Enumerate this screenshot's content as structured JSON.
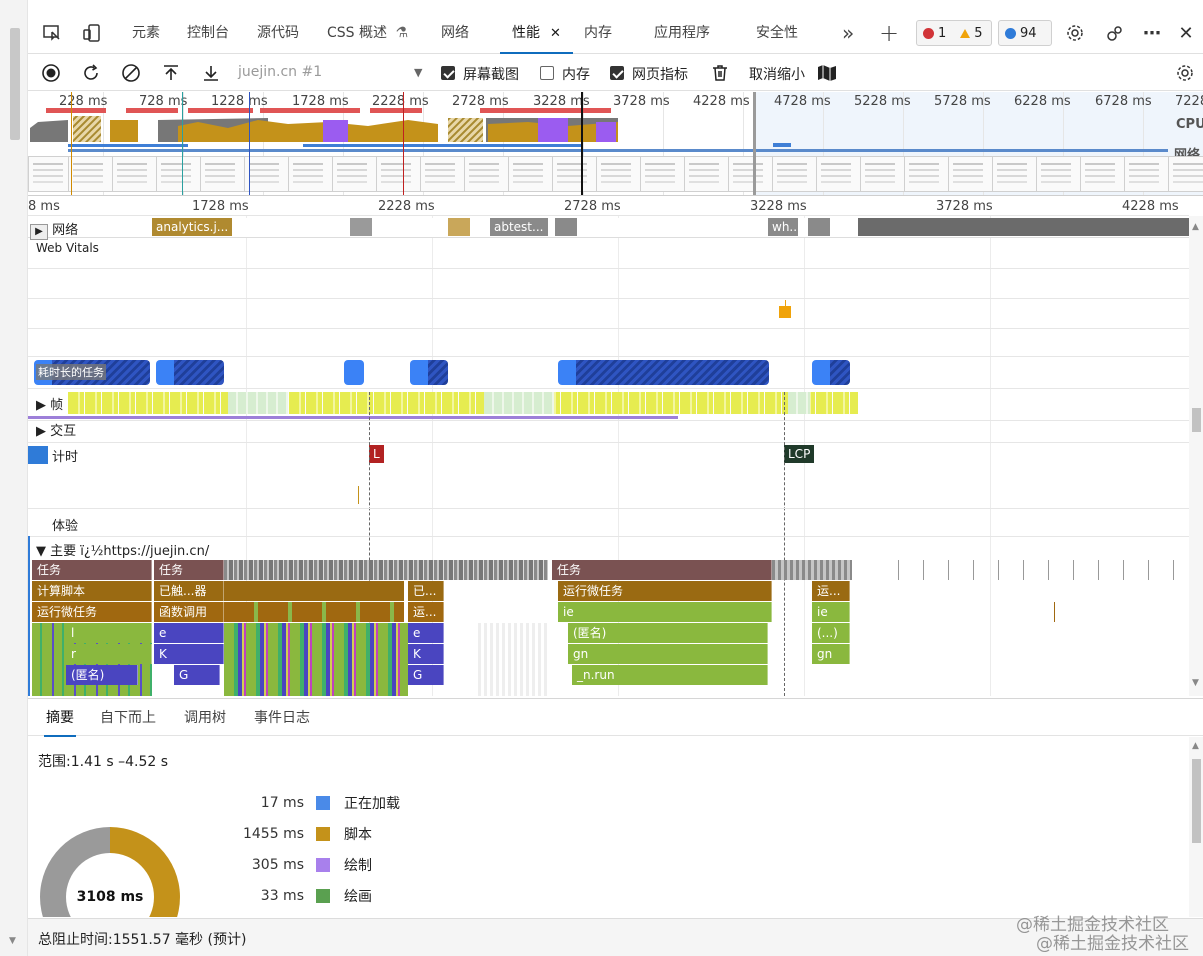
{
  "tabs": {
    "items": [
      "元素",
      "控制台",
      "源代码",
      "CSS 概述",
      "网络",
      "性能",
      "内存",
      "应用程序",
      "安全性"
    ],
    "active": "性能",
    "close_glyph": "✕",
    "more_glyph": "»",
    "add_glyph": "+"
  },
  "badges": {
    "errors": "1",
    "warnings": "5",
    "messages": "94"
  },
  "header_icons": [
    "inspect-icon",
    "device-toolbar-icon",
    "settings-gear-icon",
    "customize-icon",
    "more-menu-icon",
    "close-devtools-icon"
  ],
  "toolbar": {
    "profile_placeholder": "juejin.cn #1",
    "screenshots_label": "屏幕截图",
    "screenshots_checked": true,
    "memory_label": "内存",
    "memory_checked": false,
    "web_vitals_label": "网页指标",
    "web_vitals_checked": true,
    "zoom_out_label": "取消缩小"
  },
  "overview": {
    "ticks": [
      "228 ms",
      "728 ms",
      "1228 ms",
      "1728 ms",
      "2228 ms",
      "2728 ms",
      "3228 ms",
      "3728 ms",
      "4228 ms",
      "4728 ms",
      "5228 ms",
      "5728 ms",
      "6228 ms",
      "6728 ms",
      "7228 ms"
    ],
    "cpu_label": "CPU",
    "network_label": "网络"
  },
  "ruler": {
    "ticks": [
      "8 ms",
      "1728 ms",
      "2228 ms",
      "2728 ms",
      "3228 ms",
      "3728 ms",
      "4228 ms"
    ]
  },
  "tracks": {
    "network_label": "网络",
    "network_bars": [
      "analytics.j...",
      "abtest...",
      "wh..."
    ],
    "web_vitals_label": "Web Vitals",
    "long_tasks_label": "耗时长的任务",
    "frames_label": "帧",
    "interactions_label": "交互",
    "timings_label": "计时",
    "timing_markers": [
      "L",
      "LCP"
    ],
    "experience_label": "体验",
    "main_label": "主要 ï¿½https://juejin.cn/"
  },
  "flame": {
    "row1": [
      "任务",
      "任务",
      "任务"
    ],
    "row2": [
      "计算脚本",
      "已触...器",
      "已...",
      "运行微任务",
      "运..."
    ],
    "row3": [
      "运行微任务",
      "函数调用",
      "运...",
      "ie",
      "ie"
    ],
    "row4": [
      "l",
      "e",
      "e",
      "(匿名)",
      "(...)"
    ],
    "row5": [
      "r",
      "K",
      "K",
      "gn",
      "gn"
    ],
    "row6": [
      "(匿名)",
      "G",
      "G",
      "_n.run"
    ]
  },
  "bottom_tabs": {
    "items": [
      "摘要",
      "自下而上",
      "调用树",
      "事件日志"
    ],
    "active": "摘要"
  },
  "summary": {
    "range": "范围:1.41 s –4.52 s",
    "legend": [
      {
        "value": "17 ms",
        "name": "正在加载",
        "color": "#4a8ae8"
      },
      {
        "value": "1455 ms",
        "name": "脚本",
        "color": "#c4921a"
      },
      {
        "value": "305 ms",
        "name": "绘制",
        "color": "#a880ec"
      },
      {
        "value": "33 ms",
        "name": "绘画",
        "color": "#5aa050"
      }
    ],
    "total": "3108 ms"
  },
  "status": {
    "text": "总阻止时间:1551.57 毫秒 (预计)"
  },
  "watermark": "@稀土掘金技术社区"
}
